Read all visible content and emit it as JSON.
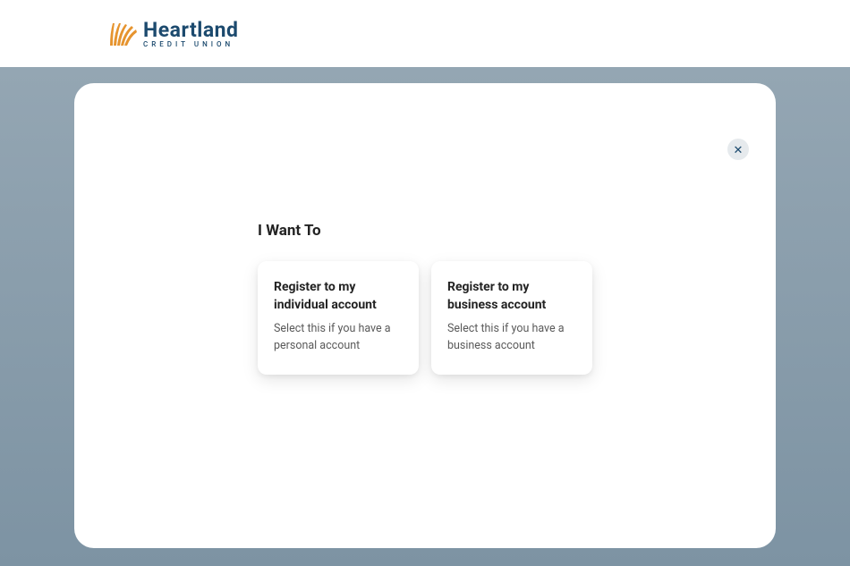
{
  "logo": {
    "main": "Heartland",
    "sub": "CREDIT UNION"
  },
  "modal": {
    "heading": "I Want To",
    "close_label": "✕",
    "cards": [
      {
        "title": "Register to my individual account",
        "desc": "Select this if you have a personal account"
      },
      {
        "title": "Register to my business account",
        "desc": "Select this if you have a business account"
      }
    ]
  }
}
